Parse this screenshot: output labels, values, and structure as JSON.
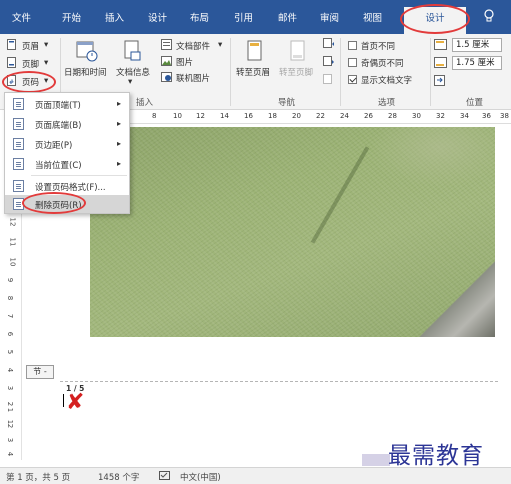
{
  "tabs": {
    "file": "文件",
    "start": "开始",
    "insert": "插入",
    "design": "设计",
    "layout": "布局",
    "references": "引用",
    "mailings": "邮件",
    "review": "审阅",
    "view": "视图",
    "header_footer_design": "设计"
  },
  "ribbon": {
    "header": "页眉",
    "footer": "页脚",
    "page_number": "页码",
    "date_time": "日期和时间",
    "doc_info": "文档信息",
    "doc_parts": "文档部件",
    "picture": "图片",
    "online_picture": "联机图片",
    "goto_header": "转至页眉",
    "goto_footer": "转至页脚",
    "different_first": "首页不同",
    "different_odd_even": "奇偶页不同",
    "show_doc_text": "显示文档文字",
    "header_distance": "1.5 厘米",
    "footer_distance": "1.75 厘米",
    "group_insert": "插入",
    "group_nav": "导航",
    "group_options": "选项",
    "group_position": "位置"
  },
  "options": {
    "different_first_checked": false,
    "different_odd_even_checked": false,
    "show_doc_text_checked": true
  },
  "menu": {
    "items": [
      {
        "label": "页面顶端(T)",
        "has_submenu": true
      },
      {
        "label": "页面底端(B)",
        "has_submenu": true
      },
      {
        "label": "页边距(P)",
        "has_submenu": true
      },
      {
        "label": "当前位置(C)",
        "has_submenu": true
      },
      {
        "label": "设置页码格式(F)...",
        "has_submenu": false
      },
      {
        "label": "删除页码(R)",
        "has_submenu": false
      }
    ],
    "highlighted_index": 5
  },
  "ruler": {
    "h_ticks": [
      "8",
      "10",
      "12",
      "14",
      "16",
      "18",
      "20",
      "22",
      "24",
      "26",
      "28",
      "30",
      "32",
      "34",
      "36",
      "38"
    ],
    "v_ticks": [
      "12",
      "11",
      "10",
      "9",
      "8",
      "7",
      "6",
      "5",
      "4",
      "3",
      "2",
      "1",
      "1",
      "2",
      "3",
      "4"
    ]
  },
  "document": {
    "section_tag": "节 -",
    "page_number_text": "1 / 5"
  },
  "status": {
    "page": "第 1 页，共 5 页",
    "words": "1458 个字",
    "language": "中文(中国)"
  },
  "watermark": "最需教育",
  "colors": {
    "accent": "#2b579a",
    "annotation_red": "#e23b3b",
    "watermark": "#2c3596"
  }
}
